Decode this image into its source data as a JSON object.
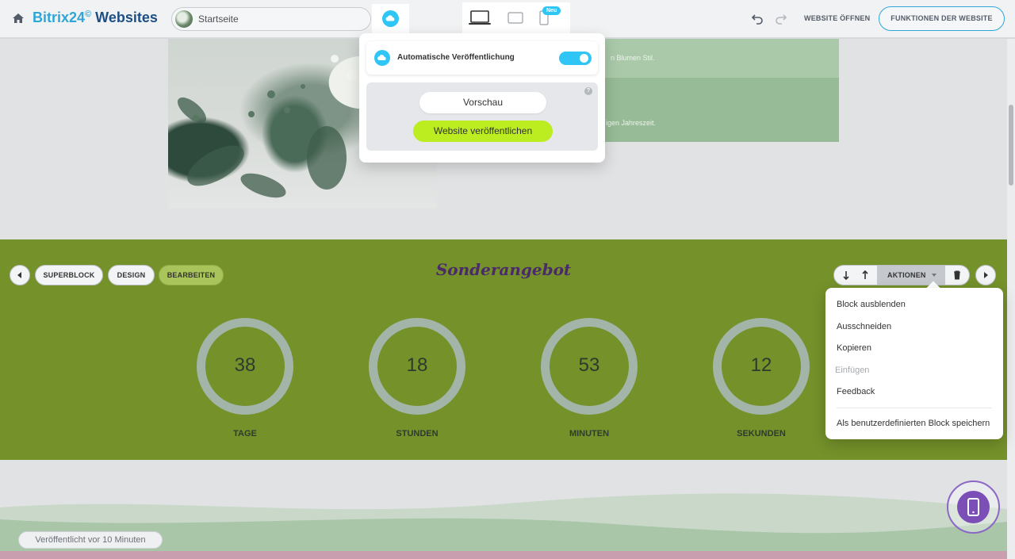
{
  "topbar": {
    "brand_part1": "Bitrix24",
    "brand_mark": "©",
    "brand_part2": "Websites",
    "page_label": "Startseite",
    "badge_new": "Neu",
    "open_site": "WEBSITE ÖFFNEN",
    "site_features": "FUNKTIONEN DER WEBSITE"
  },
  "content": {
    "panel_text_1": "n Blumen Stil.",
    "panel_text_2": "igen Jahreszeit."
  },
  "block": {
    "title": "Sonderangebot",
    "superblock": "SUPERBLOCK",
    "design": "DESIGN",
    "edit": "BEARBEITEN",
    "actions": "AKTIONEN"
  },
  "countdown": [
    {
      "value": "38",
      "label": "TAGE"
    },
    {
      "value": "18",
      "label": "STUNDEN"
    },
    {
      "value": "53",
      "label": "MINUTEN"
    },
    {
      "value": "12",
      "label": "SEKUNDEN"
    }
  ],
  "publish_popup": {
    "auto_publish_label": "Automatische Veröffentlichung",
    "auto_publish_on": true,
    "help": "?",
    "preview": "Vorschau",
    "publish": "Website veröffentlichen"
  },
  "actions_menu": {
    "items": [
      "Block ausblenden",
      "Ausschneiden",
      "Kopieren",
      "Einfügen",
      "Feedback",
      "Als benutzerdefinierten Block speichern"
    ],
    "disabled_item": "Einfügen"
  },
  "status": {
    "published": "Veröffentlicht vor 10 Minuten"
  },
  "colors": {
    "accent_blue": "#2fc6f6",
    "publish_green": "#bbed21",
    "block_green": "#74912a",
    "title_purple": "#4a2a6a",
    "fab_purple": "#7c4fb7"
  }
}
